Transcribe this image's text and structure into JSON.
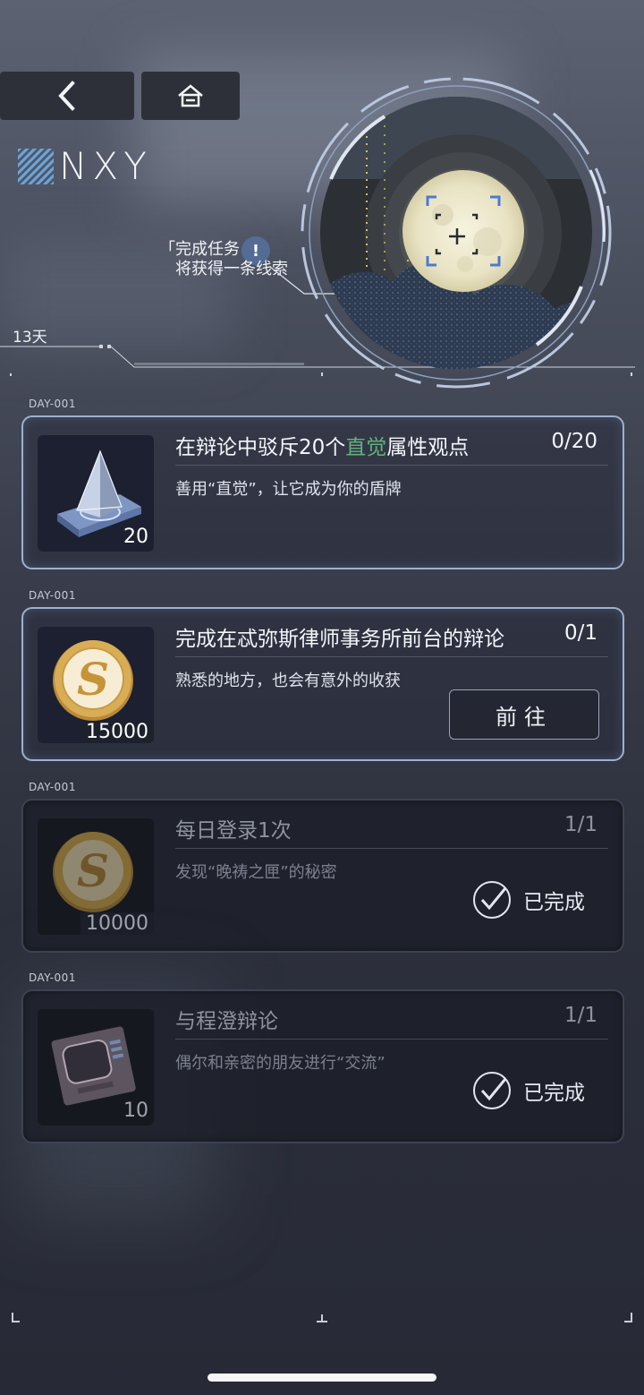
{
  "header": {
    "logo_text": "NXY",
    "hint_line1": "「完成任务",
    "hint_line2": "将获得一条线索",
    "hint_badge": "!",
    "days_label": "13天"
  },
  "tasks": [
    {
      "day": "DAY-001",
      "title_prefix": "在辩论中驳斥20个",
      "title_highlight": "直觉",
      "title_suffix": "属性观点",
      "progress": "0/20",
      "desc": "善用“直觉”，让它成为你的盾牌",
      "qty": "20",
      "icon": "crystal-prism-icon"
    },
    {
      "day": "DAY-001",
      "title": "完成在忒弥斯律师事务所前台的辩论",
      "progress": "0/1",
      "desc": "熟悉的地方，也会有意外的收获",
      "qty": "15000",
      "icon": "gold-coin-icon",
      "action_label": "前往"
    },
    {
      "day": "DAY-001",
      "title": "每日登录1次",
      "progress": "1/1",
      "desc": "发现“晚祷之匣”的秘密",
      "qty": "10000",
      "icon": "gold-coin-icon",
      "status": "已完成"
    },
    {
      "day": "DAY-001",
      "title": "与程澄辩论",
      "progress": "1/1",
      "desc": "偶尔和亲密的朋友进行“交流”",
      "qty": "10",
      "icon": "memory-chip-icon",
      "status": "已完成"
    }
  ],
  "colors": {
    "highlight": "#5fb37a",
    "card_border_active": "#9db0d0",
    "coin_gold": "#c9a14e"
  }
}
